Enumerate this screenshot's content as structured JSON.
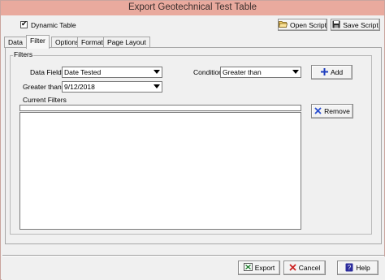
{
  "window": {
    "title": "Export Geotechnical Test Table"
  },
  "toolbar": {
    "dynamic_table_label": "Dynamic Table",
    "dynamic_table_checked": true,
    "open_script_label": "Open Script",
    "save_script_label": "Save Script"
  },
  "tabs": [
    {
      "label": "Data"
    },
    {
      "label": "Filter"
    },
    {
      "label": "Options"
    },
    {
      "label": "Format"
    },
    {
      "label": "Page Layout"
    }
  ],
  "filters": {
    "group_label": "Filters",
    "data_field_label": "Data Field:",
    "data_field_value": "Date Tested",
    "condition_label": "Condition",
    "condition_value": "Greater than",
    "add_label": "Add",
    "greater_than_label": "Greater than:",
    "greater_than_value": "9/12/2018",
    "current_filters_label": "Current Filters",
    "remove_label": "Remove",
    "current_filters": []
  },
  "footer": {
    "export_label": "Export",
    "cancel_label": "Cancel",
    "help_label": "Help"
  },
  "colors": {
    "titlebar": "#e9aa9e",
    "add_icon": "#1f3fbf",
    "remove_icon": "#2a4fd0",
    "cancel_icon": "#cc2222"
  }
}
